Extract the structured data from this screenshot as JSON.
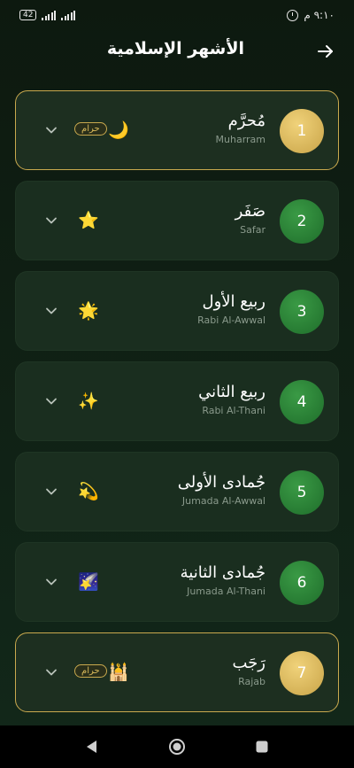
{
  "status_bar": {
    "battery": "42",
    "time": "٩:١٠ م"
  },
  "header": {
    "title": "الأشهر الإسلامية",
    "back_icon": "arrow-right-icon"
  },
  "sacred_label": "حرام",
  "months": [
    {
      "number": "1",
      "arabic": "مُحرَّم",
      "english": "Muharram",
      "emoji": "🌙",
      "sacred": true
    },
    {
      "number": "2",
      "arabic": "صَفَر",
      "english": "Safar",
      "emoji": "⭐",
      "sacred": false
    },
    {
      "number": "3",
      "arabic": "ربيع الأول",
      "english": "Rabi Al-Awwal",
      "emoji": "🌟",
      "sacred": false
    },
    {
      "number": "4",
      "arabic": "ربيع الثاني",
      "english": "Rabi Al-Thani",
      "emoji": "✨",
      "sacred": false
    },
    {
      "number": "5",
      "arabic": "جُمادى الأولى",
      "english": "Jumada Al-Awwal",
      "emoji": "💫",
      "sacred": false
    },
    {
      "number": "6",
      "arabic": "جُمادى الثانية",
      "english": "Jumada Al-Thani",
      "emoji": "🌠",
      "sacred": false
    },
    {
      "number": "7",
      "arabic": "رَجَب",
      "english": "Rajab",
      "emoji": "🕌",
      "sacred": true
    }
  ],
  "colors": {
    "background": "#0e1a10",
    "card": "#1a2e1f",
    "gold": "#c9a94e",
    "green_badge": "#2e8a3a"
  },
  "nav": {
    "back_icon": "triangle-back-icon",
    "home_icon": "circle-home-icon",
    "recents_icon": "square-recents-icon"
  }
}
